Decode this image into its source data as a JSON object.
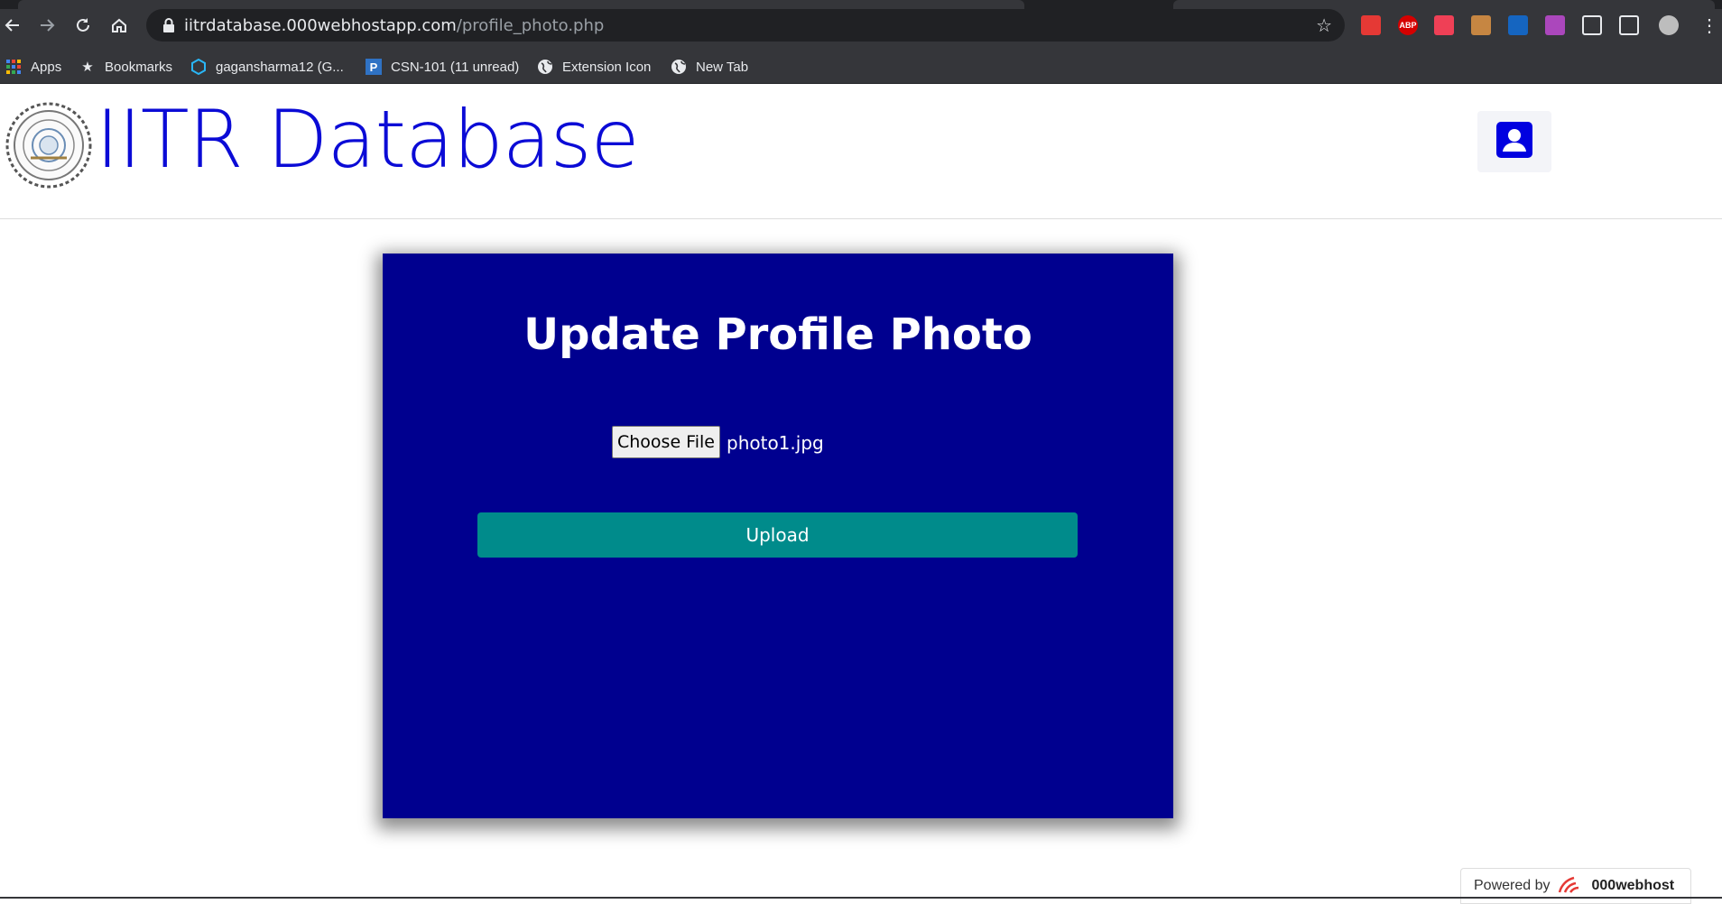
{
  "browser": {
    "url_host": "iitrdatabase.000webhostapp.com",
    "url_path": "/profile_photo.php",
    "bookmarks": [
      {
        "label": "Apps",
        "icon": "apps-grid-icon"
      },
      {
        "label": "Bookmarks",
        "icon": "star-icon"
      },
      {
        "label": "gagansharma12 (G...",
        "icon": "hexagon-icon"
      },
      {
        "label": "CSN-101 (11 unread)",
        "icon": "p-icon"
      },
      {
        "label": "Extension Icon",
        "icon": "globe-icon"
      },
      {
        "label": "New Tab",
        "icon": "globe-icon"
      }
    ],
    "extensions": [
      {
        "name": "bookmark-red-icon",
        "color": "#e53935"
      },
      {
        "name": "adblock-icon",
        "color": "#d50000",
        "text": "ABP"
      },
      {
        "name": "pocket-icon",
        "color": "#ef4056"
      },
      {
        "name": "cookie-icon",
        "color": "#c68642"
      },
      {
        "name": "color-bars-icon",
        "color": "#1565c0"
      },
      {
        "name": "color-grid-icon",
        "color": "#ab47bc"
      },
      {
        "name": "puzzle-icon",
        "color": "#e8eaed"
      },
      {
        "name": "playlist-icon",
        "color": "#e8eaed"
      },
      {
        "name": "profile-avatar-icon",
        "color": "#bdbdbd"
      }
    ]
  },
  "header": {
    "title": "IITR Database",
    "title_color": "#0b0bd6"
  },
  "card": {
    "title": "Update Profile Photo",
    "choose_file_label": "Choose File",
    "file_name": "photo1.jpg",
    "upload_label": "Upload",
    "background": "#00008f",
    "button_color": "#008b8b"
  },
  "footer": {
    "powered_by": "Powered by",
    "brand": "000webhost"
  }
}
